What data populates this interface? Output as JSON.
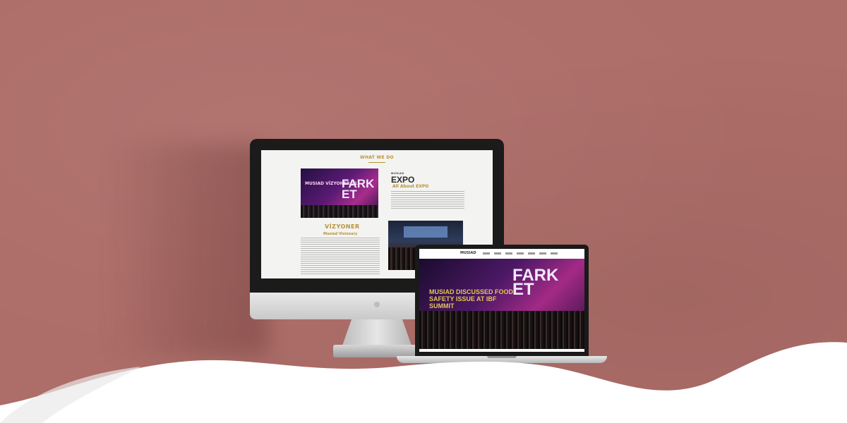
{
  "colors": {
    "background": "#ad6d68",
    "wave": "#ffffff",
    "accent_gold": "#b8923a"
  },
  "desktop_site": {
    "section_heading": "WHAT WE DO",
    "expo_logo_small": "MUSIAD",
    "expo_logo_big": "EXPO",
    "expo_title": "All About EXPO",
    "hero_text": "FARK ET",
    "side_text": "MUSIAD VİZYONER-21",
    "vizyoner_logo": "VİZYONER",
    "vizyoner_title": "Musiad Visionary"
  },
  "laptop_site": {
    "logo": "MUSIAD",
    "headline": "MUSIAD DISCUSSED FOOD SAFETY ISSUE AT IBF SUMMIT",
    "hero_text": "FARK ET"
  }
}
